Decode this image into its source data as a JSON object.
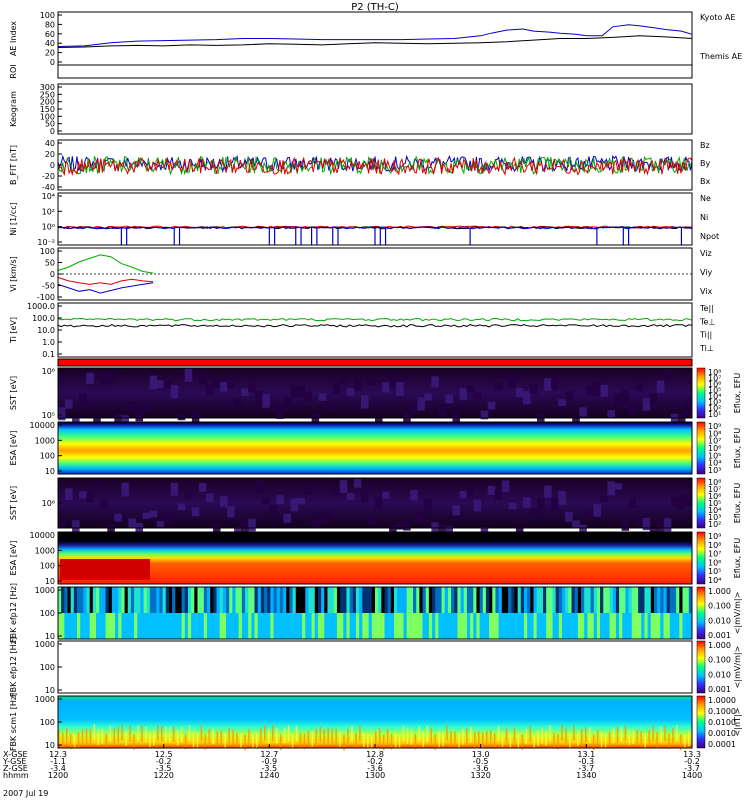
{
  "title": "P2 (TH-C)",
  "date": "2007 Jul 19",
  "chart_data": {
    "type": "line",
    "x": {
      "label": "hhmm",
      "ticks": [
        "1200",
        "1220",
        "1240",
        "1300",
        "1320",
        "1340",
        "1400"
      ],
      "range": [
        "1200",
        "1400"
      ]
    },
    "ephemeris": [
      {
        "label": "X-GSE",
        "values": [
          "12.3",
          "12.5",
          "12.7",
          "12.8",
          "13.0",
          "13.1",
          "13.3"
        ]
      },
      {
        "label": "Y-GSE",
        "values": [
          "-1.1",
          "-0.2",
          "-0.9",
          "-0.2",
          "-0.5",
          "-0.3",
          "-0.2"
        ]
      },
      {
        "label": "Z-GSE",
        "values": [
          "-3.4",
          "-3.5",
          "-3.5",
          "-3.6",
          "-3.6",
          "-3.7",
          "-3.7"
        ]
      }
    ],
    "panels": [
      {
        "name": "ae",
        "ylabel": "AE Index",
        "ylim": [
          0,
          100
        ],
        "yticks": [
          "100",
          "80",
          "60",
          "40",
          "20",
          "0"
        ],
        "legend": [
          {
            "label": "Kyoto AE",
            "color": "#0000cc"
          },
          {
            "label": "Themis AE",
            "color": "#000000"
          }
        ],
        "series": [
          {
            "name": "Kyoto AE",
            "color": "#0000cc",
            "x": [
              1200,
              1205,
              1210,
              1215,
              1220,
              1225,
              1230,
              1235,
              1240,
              1245,
              1250,
              1255,
              1300,
              1305,
              1310,
              1315,
              1320,
              1322,
              1325,
              1328,
              1330,
              1333,
              1335,
              1338,
              1340,
              1343,
              1345,
              1348,
              1350,
              1353,
              1355,
              1358,
              1400
            ],
            "y": [
              35,
              36,
              42,
              45,
              46,
              47,
              48,
              50,
              50,
              49,
              48,
              48,
              48,
              48,
              49,
              50,
              55,
              60,
              66,
              68,
              64,
              62,
              60,
              58,
              55,
              55,
              72,
              76,
              74,
              70,
              67,
              64,
              58
            ]
          },
          {
            "name": "Themis AE",
            "color": "#000000",
            "x": [
              1200,
              1205,
              1210,
              1215,
              1220,
              1225,
              1230,
              1235,
              1240,
              1245,
              1250,
              1255,
              1300,
              1305,
              1310,
              1315,
              1320,
              1325,
              1330,
              1335,
              1340,
              1345,
              1350,
              1355,
              1400
            ],
            "y": [
              33,
              34,
              36,
              37,
              36,
              38,
              37,
              38,
              40,
              39,
              38,
              40,
              42,
              41,
              40,
              41,
              42,
              44,
              47,
              50,
              50,
              52,
              55,
              53,
              50
            ]
          }
        ]
      },
      {
        "name": "roi",
        "ylabel": "ROI",
        "series": []
      },
      {
        "name": "keogram",
        "ylabel": "Keogram",
        "yticks": [
          "300",
          "250",
          "200",
          "150",
          "100",
          "50",
          "0"
        ],
        "series": []
      },
      {
        "name": "bfit",
        "ylabel": "B_FIT [nT]",
        "ylim": [
          -40,
          40
        ],
        "yticks": [
          "40",
          "20",
          "0",
          "-20",
          "-40"
        ],
        "legend": [
          {
            "label": "Bz",
            "color": "#dd0000"
          },
          {
            "label": "By",
            "color": "#00aa00"
          },
          {
            "label": "Bx",
            "color": "#0000cc"
          }
        ],
        "series": [
          {
            "name": "Bx",
            "color": "#0000cc",
            "mean": 2,
            "amplitude": 12
          },
          {
            "name": "By",
            "color": "#00aa00",
            "mean": 0,
            "amplitude": 14
          },
          {
            "name": "Bz",
            "color": "#dd0000",
            "mean": -2,
            "amplitude": 13
          }
        ]
      },
      {
        "name": "density",
        "ylabel": "Ni [1/cc]",
        "ylim": [
          0.01,
          10000
        ],
        "yscale": "log",
        "yticks": [
          "10⁴",
          "10²",
          "10⁰",
          "10⁻²"
        ],
        "legend": [
          {
            "label": "Ne",
            "color": "#dd0000"
          },
          {
            "label": "Ni",
            "color": "#000000"
          },
          {
            "label": "Npot",
            "color": "#0000cc"
          }
        ],
        "series": [
          {
            "name": "Ne",
            "color": "#dd0000",
            "value": 1.2
          },
          {
            "name": "Ni",
            "color": "#000000",
            "value": 1.0
          },
          {
            "name": "Npot",
            "color": "#0000cc",
            "value": 1.0
          }
        ]
      },
      {
        "name": "velocity",
        "ylabel": "Vi [km/s]",
        "ylim": [
          -150,
          150
        ],
        "yticks": [
          "100",
          "50",
          "0",
          "-50",
          "-100"
        ],
        "legend": [
          {
            "label": "Viz",
            "color": "#dd0000"
          },
          {
            "label": "Viy",
            "color": "#00aa00"
          },
          {
            "label": "Vix",
            "color": "#0000cc"
          }
        ],
        "series": [
          {
            "name": "Vix",
            "color": "#0000cc",
            "x": [
              1200,
              1202,
              1204,
              1206,
              1208,
              1210,
              1212,
              1214,
              1216,
              1218
            ],
            "y": [
              -60,
              -80,
              -100,
              -90,
              -110,
              -95,
              -80,
              -70,
              -60,
              -50
            ]
          },
          {
            "name": "Viy",
            "color": "#00aa00",
            "x": [
              1200,
              1202,
              1204,
              1206,
              1208,
              1210,
              1212,
              1214,
              1216,
              1218
            ],
            "y": [
              20,
              40,
              70,
              90,
              110,
              100,
              60,
              40,
              15,
              5
            ]
          },
          {
            "name": "Viz",
            "color": "#dd0000",
            "x": [
              1200,
              1202,
              1204,
              1206,
              1208,
              1210,
              1212,
              1214,
              1216,
              1218
            ],
            "y": [
              -20,
              -40,
              -50,
              -60,
              -50,
              -60,
              -40,
              -30,
              -40,
              -45
            ]
          }
        ]
      },
      {
        "name": "temperature",
        "ylabel": "Ti [eV]",
        "ylim": [
          0.1,
          10000
        ],
        "yscale": "log",
        "yticks": [
          "1000.0",
          "100.0",
          "10.0",
          "1.0",
          "0.1"
        ],
        "legend": [
          {
            "label": "Te||",
            "color": "#000000"
          },
          {
            "label": "Te⊥",
            "color": "#dd0000"
          },
          {
            "label": "Ti||",
            "color": "#00aa00"
          },
          {
            "label": "Ti⊥",
            "color": "#0000cc"
          }
        ],
        "series": [
          {
            "name": "Ti||",
            "color": "#00aa00",
            "value": 300
          },
          {
            "name": "Te||",
            "color": "#000000",
            "value": 80
          }
        ]
      },
      {
        "name": "mode",
        "ylabel": "",
        "series": []
      },
      {
        "name": "sst-ion",
        "ylabel": "SST [eV]",
        "yticks": [
          "10⁶",
          "10⁵"
        ],
        "colorbar": "Eflux, EFU",
        "colorbar_ticks": [
          "10⁸",
          "10⁷",
          "10⁶",
          "10⁵",
          "10⁴",
          "10³",
          "10²",
          "10¹"
        ]
      },
      {
        "name": "esa-ion",
        "ylabel": "ESA [eV]",
        "yticks": [
          "10000",
          "1000",
          "100",
          "10"
        ],
        "colorbar": "Eflux, EFU",
        "colorbar_ticks": [
          "10⁹",
          "10⁸",
          "10⁷",
          "10⁶",
          "10⁵",
          "10⁴",
          "10³"
        ]
      },
      {
        "name": "sst-elec",
        "ylabel": "SST [eV]",
        "yticks": [
          "10⁶"
        ],
        "colorbar": "Eflux, EFU",
        "colorbar_ticks": [
          "10⁸",
          "10⁷",
          "10⁶",
          "10⁵",
          "10⁴",
          "10³",
          "10²"
        ]
      },
      {
        "name": "esa-elec",
        "ylabel": "ESA [eV]",
        "yticks": [
          "10000",
          "1000",
          "100",
          "10"
        ],
        "colorbar": "Eflux, EFU",
        "colorbar_ticks": [
          "10⁹",
          "10⁸",
          "10⁷",
          "10⁶",
          "10⁵",
          "10⁴"
        ]
      },
      {
        "name": "fbk-efi",
        "ylabel": "FBK efp12 [Hz]",
        "yticks": [
          "1000",
          "100",
          "10"
        ],
        "colorbar": "<|mV/m|>",
        "colorbar_ticks": [
          "1.000",
          "0.100",
          "0.010",
          "0.001"
        ]
      },
      {
        "name": "fbk-efi2",
        "ylabel": "FBK efp12 [Hz]",
        "yticks": [
          "1000",
          "100",
          "10"
        ],
        "colorbar": "<|mV/m|>",
        "colorbar_ticks": [
          "1.000",
          "0.100",
          "0.010",
          "0.001"
        ]
      },
      {
        "name": "fbk-scm",
        "ylabel": "FBK scm1 [Hz]",
        "yticks": [
          "1000",
          "100",
          "10"
        ],
        "colorbar": "<|nT|>",
        "colorbar_ticks": [
          "1.0000",
          "0.1000",
          "0.0100",
          "0.0010",
          "0.0001"
        ]
      }
    ]
  }
}
